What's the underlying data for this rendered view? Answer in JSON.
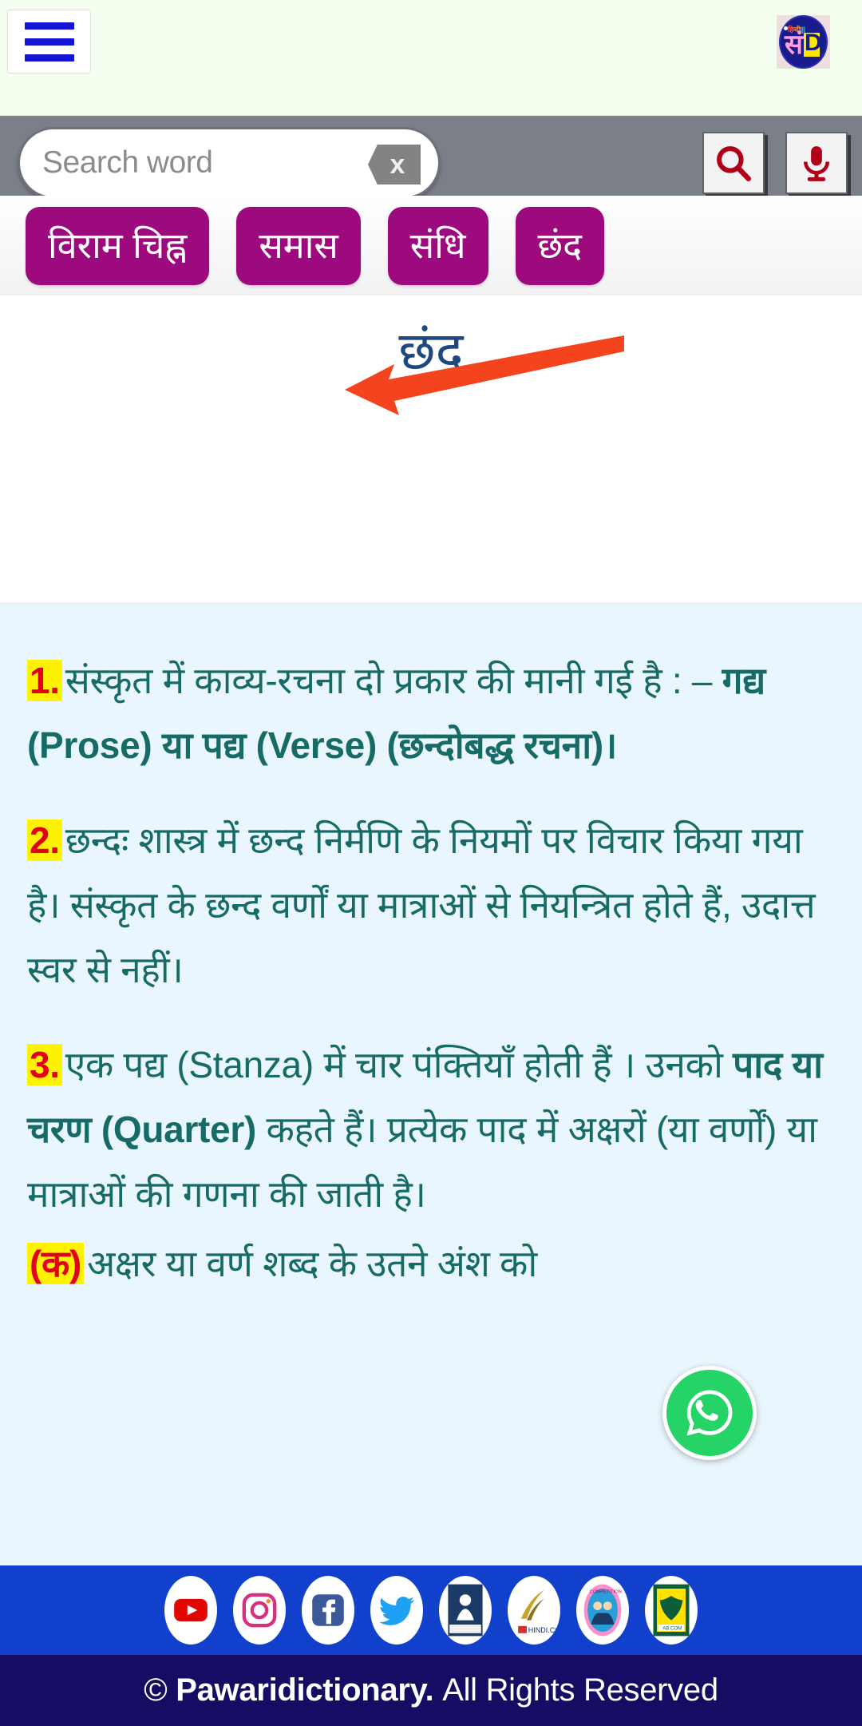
{
  "header": {
    "menu_icon": "hamburger-menu-icon",
    "logo_alt": "Pawari Dictionary logo",
    "logo_text_top": "हिन्दी",
    "logo_text_main": "सं",
    "logo_text_d": "D"
  },
  "search": {
    "placeholder": "Search word",
    "value": "",
    "clear_label": "x",
    "search_icon": "search-icon",
    "mic_icon": "microphone-icon"
  },
  "categories": [
    {
      "label": "विराम चिह्न"
    },
    {
      "label": "समास"
    },
    {
      "label": "संधि"
    },
    {
      "label": "छंद"
    }
  ],
  "page": {
    "title": "छंद",
    "title_color": "#1c4a80",
    "arrow_color": "#f4441e",
    "accent_purple": "#9c0a7e",
    "body_color": "#176b66",
    "highlight_bg": "#fff200",
    "highlight_fg": "#e2001a",
    "content_bg": "#eaf6fd"
  },
  "content": {
    "items": [
      {
        "marker": "1.",
        "text_plain": "संस्कृत में काव्य-रचना दो प्रकार की मानी गई है : – ",
        "text_bold": "गद्य (Prose) या पद्य (Verse) (छन्दोबद्ध रचना)।"
      },
      {
        "marker": "2.",
        "text_plain": "छन्दः शास्त्र में छन्द निर्मणि के नियमों पर विचार किया गया है। संस्कृत के छन्द वर्णों या मात्राओं से नियन्त्रित होते हैं, उदात्त स्वर से नहीं।",
        "text_bold": ""
      },
      {
        "marker": "3.",
        "text_plain": "एक पद्य (Stanza) में चार पंक्तियाँ होती हैं । उनको ",
        "text_bold": "पाद या चरण (Quarter)",
        "text_tail": " कहते हैं। प्रत्येक पाद में अक्षरों (या वर्णों) या मात्राओं की गणना की जाती है।"
      },
      {
        "marker": "(क)",
        "text_plain": "अक्षर या वर्ण शब्द के उतने अंश को",
        "text_bold": ""
      }
    ]
  },
  "floating": {
    "whatsapp_label": "whatsapp-icon"
  },
  "footer": {
    "social": [
      {
        "name": "youtube-icon",
        "label": "YouTube"
      },
      {
        "name": "instagram-icon",
        "label": "Instagram"
      },
      {
        "name": "facebook-icon",
        "label": "Facebook"
      },
      {
        "name": "twitter-icon",
        "label": "Twitter"
      },
      {
        "name": "sanskrit-site-icon",
        "label": "Sanskrit"
      },
      {
        "name": "hindicom-icon",
        "label": "HINDI.COM"
      },
      {
        "name": "competition-icon",
        "label": "Competition"
      },
      {
        "name": "ab-com-icon",
        "label": "AB.COM"
      }
    ],
    "copyright_symbol": "©",
    "copyright_brand": "Pawaridictionary.",
    "copyright_rest": "All Rights Reserved"
  }
}
